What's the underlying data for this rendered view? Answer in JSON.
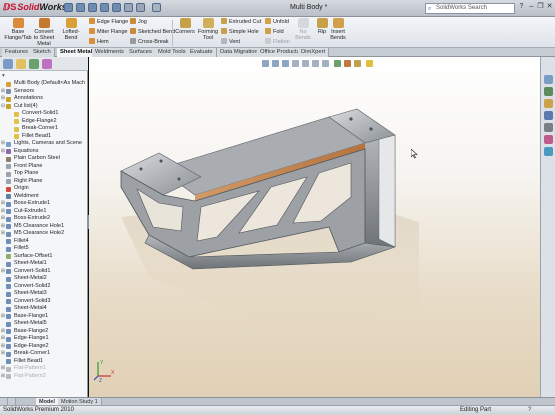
{
  "titlebar": {
    "logo_brand": "Solid",
    "logo_rest": "Works",
    "window_title": "Multi Body *",
    "search_placeholder": "SolidWorks Search",
    "help": "?",
    "minimize": "–",
    "restore": "❐",
    "close": "✕"
  },
  "ribbon": {
    "base_flange": "Base\nFlange/Tab",
    "convert_to_sheet_metal": "Convert\nto Sheet\nMetal",
    "lofted_bend": "Lofted-Bend",
    "edge_flange": "Edge Flange",
    "miter_flange": "Miter Flange",
    "hem": "Hem",
    "jog": "Jog",
    "sketched_bend": "Sketched Bend",
    "cross_break": "Cross-Break",
    "corners": "Corners",
    "forming_tool": "Forming\nTool",
    "extruded_cut": "Extruded Cut",
    "simple_hole": "Simple Hole",
    "vent": "Vent",
    "unfold": "Unfold",
    "fold": "Fold",
    "no_bends": "No Bends",
    "flatten": "Flatten",
    "rip": "Rip",
    "insert_bends": "Insert\nBends"
  },
  "tabs": [
    "Features",
    "Sketch",
    "Sheet Metal",
    "Weldments",
    "Surfaces",
    "Mold Tools",
    "Evaluate",
    "Data Migration",
    "Office Products",
    "DimXpert"
  ],
  "active_tab": "Sheet Metal",
  "tree": {
    "filter_label": "▾",
    "root": "Multi Body  (Default<As Mach",
    "items": [
      {
        "label": "Sensors",
        "indent": 1,
        "exp": "+",
        "color": "#7a8fa8"
      },
      {
        "label": "Annotations",
        "indent": 1,
        "exp": "+",
        "color": "#c9a227"
      },
      {
        "label": "Cut list(4)",
        "indent": 1,
        "exp": "−",
        "color": "#c9a227"
      },
      {
        "label": "Convert-Solid1",
        "indent": 2,
        "exp": "",
        "color": "#e0c24a"
      },
      {
        "label": "Edge-Flange2",
        "indent": 2,
        "exp": "",
        "color": "#e0c24a"
      },
      {
        "label": "Break-Corner1",
        "indent": 2,
        "exp": "",
        "color": "#e0c24a"
      },
      {
        "label": "Fillet Bead1",
        "indent": 2,
        "exp": "",
        "color": "#e0c24a"
      },
      {
        "label": "Lights, Cameras and Scene",
        "indent": 1,
        "exp": "+",
        "color": "#7aa0c8"
      },
      {
        "label": "Equations",
        "indent": 1,
        "exp": "+",
        "color": "#8a6bb0"
      },
      {
        "label": "Plain Carbon Steel",
        "indent": 1,
        "exp": "",
        "color": "#8a7f6a"
      },
      {
        "label": "Front Plane",
        "indent": 1,
        "exp": "",
        "color": "#9aa3ad"
      },
      {
        "label": "Top Plane",
        "indent": 1,
        "exp": "",
        "color": "#9aa3ad"
      },
      {
        "label": "Right Plane",
        "indent": 1,
        "exp": "",
        "color": "#9aa3ad"
      },
      {
        "label": "Origin",
        "indent": 1,
        "exp": "",
        "color": "#d14a3a"
      },
      {
        "label": "Weldment",
        "indent": 1,
        "exp": "",
        "color": "#5f7fa6"
      },
      {
        "label": "Boss-Extrude1",
        "indent": 1,
        "exp": "+",
        "color": "#6d8fb8"
      },
      {
        "label": "Cut-Extrude1",
        "indent": 1,
        "exp": "+",
        "color": "#6d8fb8"
      },
      {
        "label": "Boss-Extrude2",
        "indent": 1,
        "exp": "+",
        "color": "#6d8fb8"
      },
      {
        "label": "M5 Clearance Hole1",
        "indent": 1,
        "exp": "+",
        "color": "#6d8fb8"
      },
      {
        "label": "M5 Clearance Hole2",
        "indent": 1,
        "exp": "+",
        "color": "#6d8fb8"
      },
      {
        "label": "Fillet4",
        "indent": 1,
        "exp": "",
        "color": "#6d8fb8"
      },
      {
        "label": "Fillet5",
        "indent": 1,
        "exp": "",
        "color": "#6d8fb8"
      },
      {
        "label": "Surface-Offset1",
        "indent": 1,
        "exp": "",
        "color": "#8fb06d"
      },
      {
        "label": "Sheet-Metal1",
        "indent": 1,
        "exp": "",
        "color": "#6d8fb8"
      },
      {
        "label": "Convert-Solid1",
        "indent": 1,
        "exp": "+",
        "color": "#6d8fb8"
      },
      {
        "label": "Sheet-Metal2",
        "indent": 1,
        "exp": "",
        "color": "#6d8fb8"
      },
      {
        "label": "Convert-Solid2",
        "indent": 1,
        "exp": "",
        "color": "#6d8fb8"
      },
      {
        "label": "Sheet-Metal3",
        "indent": 1,
        "exp": "",
        "color": "#6d8fb8"
      },
      {
        "label": "Convert-Solid3",
        "indent": 1,
        "exp": "",
        "color": "#6d8fb8"
      },
      {
        "label": "Sheet-Metal4",
        "indent": 1,
        "exp": "",
        "color": "#6d8fb8"
      },
      {
        "label": "Base-Flange1",
        "indent": 1,
        "exp": "+",
        "color": "#6d8fb8"
      },
      {
        "label": "Sheet-Metal5",
        "indent": 1,
        "exp": "",
        "color": "#6d8fb8"
      },
      {
        "label": "Base-Flange2",
        "indent": 1,
        "exp": "+",
        "color": "#6d8fb8"
      },
      {
        "label": "Edge-Flange1",
        "indent": 1,
        "exp": "+",
        "color": "#6d8fb8"
      },
      {
        "label": "Edge-Flange2",
        "indent": 1,
        "exp": "+",
        "color": "#6d8fb8"
      },
      {
        "label": "Break-Corner1",
        "indent": 1,
        "exp": "+",
        "color": "#6d8fb8"
      },
      {
        "label": "Fillet Bead1",
        "indent": 1,
        "exp": "",
        "color": "#6d8fb8"
      },
      {
        "label": "Flat-Pattern1",
        "indent": 1,
        "exp": "+",
        "color": "#b5bac0",
        "faded": true
      },
      {
        "label": "Flat-Pattern2",
        "indent": 1,
        "exp": "+",
        "color": "#b5bac0",
        "faded": true
      }
    ]
  },
  "bottom_tabs": [
    "Model",
    "Motion Study 1"
  ],
  "status": {
    "left": "SolidWorks Premium 2010",
    "right": "Editing Part",
    "help": "?"
  },
  "triad": {
    "x": "X",
    "y": "Y",
    "z": "Z"
  },
  "colors": {
    "accent_brand": "#c8102e",
    "ribbon_bg": "#e6eaef",
    "model_metal": "#9ea2a6",
    "model_face": "#c98a5a",
    "background_top": "#ffffff",
    "background_floor": "#e0d0b5"
  }
}
